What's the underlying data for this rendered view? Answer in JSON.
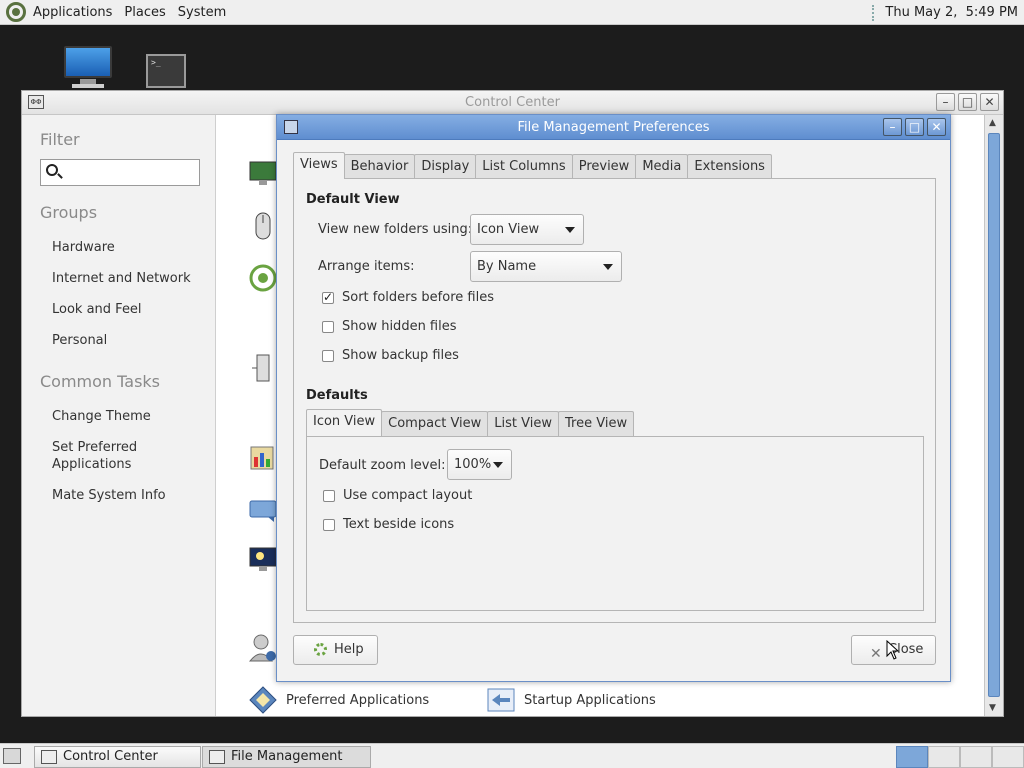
{
  "top_panel": {
    "menus": [
      "Applications",
      "Places",
      "System"
    ],
    "clock": "Thu May 2,  5:49 PM"
  },
  "control_center": {
    "title": "Control Center",
    "filter_heading": "Filter",
    "groups_heading": "Groups",
    "groups": [
      "Hardware",
      "Internet and Network",
      "Look and Feel",
      "Personal"
    ],
    "common_tasks_heading": "Common Tasks",
    "tasks": [
      "Change Theme",
      "Set Preferred\nApplications",
      "Mate System Info"
    ],
    "visible_items": [
      "Preferred Applications",
      "Startup Applications"
    ]
  },
  "dialog": {
    "title": "File Management Preferences",
    "tabs": [
      "Views",
      "Behavior",
      "Display",
      "List Columns",
      "Preview",
      "Media",
      "Extensions"
    ],
    "active_tab": "Views",
    "default_view_heading": "Default View",
    "view_new_folders_label": "View new folders using:",
    "view_new_folders_value": "Icon View",
    "arrange_items_label": "Arrange items:",
    "arrange_items_value": "By Name",
    "checkboxes": [
      {
        "label": "Sort folders before files",
        "checked": true
      },
      {
        "label": "Show hidden files",
        "checked": false
      },
      {
        "label": "Show backup files",
        "checked": false
      }
    ],
    "defaults_heading": "Defaults",
    "sub_tabs": [
      "Icon View",
      "Compact View",
      "List View",
      "Tree View"
    ],
    "active_sub_tab": "Icon View",
    "zoom_label": "Default zoom level:",
    "zoom_value": "100%",
    "sub_checkboxes": [
      {
        "label": "Use compact layout",
        "checked": false
      },
      {
        "label": "Text beside icons",
        "checked": false
      }
    ],
    "help_button": "Help",
    "close_button": "Close"
  },
  "taskbar": {
    "tasks": [
      "Control Center",
      "File Management Pr..."
    ]
  },
  "colors": {
    "titlebar_active": "#6b97d6",
    "selection": "#7da7d9",
    "mate_green": "#59713f"
  }
}
